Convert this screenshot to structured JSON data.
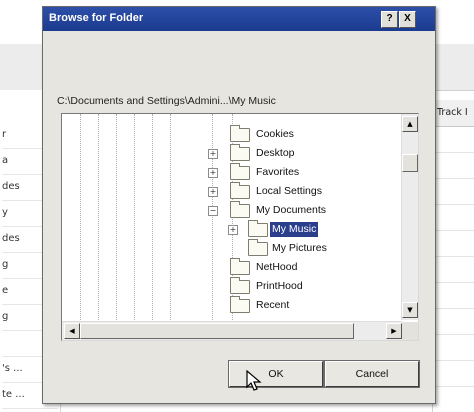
{
  "background": {
    "left_column_cells": [
      "r",
      "a",
      "des",
      "y",
      "des",
      "g",
      "e",
      "g",
      "",
      "'s ...",
      "te ..."
    ],
    "right_column_header": "Track I"
  },
  "dialog": {
    "title": "Browse for Folder",
    "help_button": "?",
    "close_button": "X",
    "current_path": "C:\\Documents and Settings\\Admini...\\My Music",
    "tree_items": [
      {
        "label": "Cookies",
        "expander": "",
        "selected": false
      },
      {
        "label": "Desktop",
        "expander": "+",
        "selected": false
      },
      {
        "label": "Favorites",
        "expander": "+",
        "selected": false
      },
      {
        "label": "Local Settings",
        "expander": "+",
        "selected": false
      },
      {
        "label": "My Documents",
        "expander": "−",
        "selected": false
      },
      {
        "label": "My Music",
        "expander": "+",
        "selected": true
      },
      {
        "label": "My Pictures",
        "expander": "",
        "selected": false
      },
      {
        "label": "NetHood",
        "expander": "",
        "selected": false
      },
      {
        "label": "PrintHood",
        "expander": "",
        "selected": false
      },
      {
        "label": "Recent",
        "expander": "",
        "selected": false
      }
    ],
    "ok_label": "OK",
    "cancel_label": "Cancel"
  },
  "icons": {
    "folder": "folder-icon",
    "cursor": "mouse-pointer-icon"
  },
  "colors": {
    "titlebar": "#1b3b8f",
    "selection": "#2a3e8c",
    "dialog_bg": "#e7e5df"
  }
}
